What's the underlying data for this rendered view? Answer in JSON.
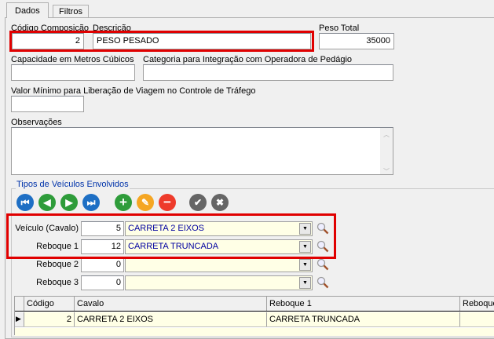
{
  "tabs": [
    "Dados",
    "Filtros"
  ],
  "form": {
    "codigo_label": "Código Composição",
    "codigo_value": "2",
    "descricao_label": "Descrição",
    "descricao_value": "PESO PESADO",
    "peso_label": "Peso Total",
    "peso_value": "35000",
    "capacidade_label": "Capacidade em Metros Cúbicos",
    "capacidade_value": "",
    "categoria_label": "Categoria para Integração com Operadora de Pedágio",
    "categoria_value": "",
    "valor_label": "Valor Mínimo para Liberação de Viagem no Controle de Tráfego",
    "valor_value": "",
    "obs_label": "Observações",
    "obs_value": ""
  },
  "group": {
    "title": "Tipos de Veículos Envolvidos",
    "rows": [
      {
        "label": "Veículo (Cavalo)",
        "code": "5",
        "desc": "CARRETA 2 EIXOS"
      },
      {
        "label": "Reboque 1",
        "code": "12",
        "desc": "CARRETA TRUNCADA"
      },
      {
        "label": "Reboque 2",
        "code": "0",
        "desc": ""
      },
      {
        "label": "Reboque 3",
        "code": "0",
        "desc": ""
      }
    ]
  },
  "grid": {
    "headers": [
      "Código",
      "Cavalo",
      "Reboque 1",
      "Reboque"
    ],
    "rows": [
      {
        "codigo": "2",
        "cavalo": "CARRETA 2 EIXOS",
        "reboque1": "CARRETA TRUNCADA",
        "reboque": ""
      }
    ]
  },
  "colors": {
    "highlight": "#e00000",
    "combo_bg": "#ffffe6"
  }
}
